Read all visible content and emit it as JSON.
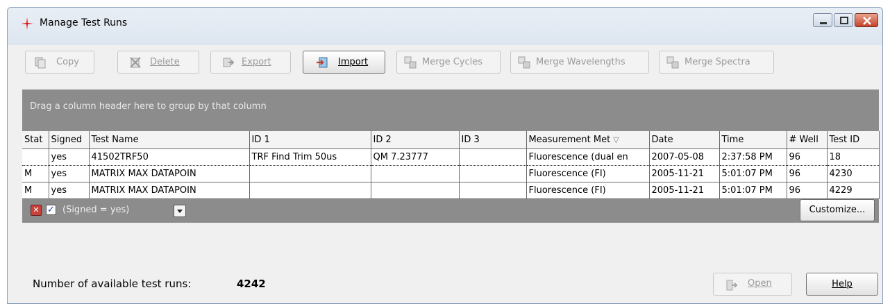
{
  "window": {
    "title": "Manage Test Runs",
    "icon": "red-cross-star-icon"
  },
  "toolbar": {
    "copy": {
      "label": "Copy",
      "icon": "copy-icon",
      "enabled": false
    },
    "delete": {
      "label": "Delete",
      "icon": "delete-icon",
      "enabled": false
    },
    "export": {
      "label": "Export",
      "icon": "export-icon",
      "enabled": false
    },
    "import": {
      "label": "Import",
      "icon": "import-icon",
      "enabled": true
    },
    "merge_cycles": {
      "label": "Merge Cycles",
      "icon": "merge-icon",
      "enabled": false
    },
    "merge_wavelengths": {
      "label": "Merge Wavelengths",
      "icon": "merge-icon",
      "enabled": false
    },
    "merge_spectra": {
      "label": "Merge Spectra",
      "icon": "merge-icon",
      "enabled": false
    }
  },
  "grid": {
    "group_hint": "Drag a column header here to group by that column",
    "columns": [
      "Stat",
      "Signed",
      "Test Name",
      "ID 1",
      "ID 2",
      "ID 3",
      "Measurement Met",
      "Date",
      "Time",
      "# Well",
      "Test ID"
    ],
    "sorted_column": "Measurement Met",
    "rows": [
      [
        "",
        "yes",
        "41502TRF50",
        "TRF Find Trim 50us",
        "QM 7.23777",
        "",
        "Fluorescence (dual en",
        "2007-05-08",
        "2:37:58 PM",
        "96",
        "18"
      ],
      [
        "M",
        "yes",
        "MATRIX  MAX DATAPOIN",
        "",
        "",
        "",
        "Fluorescence (FI)",
        "2005-11-21",
        "5:01:07 PM",
        "96",
        "4230"
      ],
      [
        "M",
        "yes",
        "MATRIX  MAX DATAPOIN",
        "",
        "",
        "",
        "Fluorescence (FI)",
        "2005-11-21",
        "5:01:07 PM",
        "96",
        "4229"
      ]
    ],
    "selected_row": 0
  },
  "filter": {
    "checked": true,
    "text": "(Signed = yes)",
    "customize_label": "Customize..."
  },
  "footer": {
    "count_label": "Number of available test runs:",
    "count_value": "4242",
    "open_label": "Open",
    "help_label": "Help"
  },
  "colors": {
    "accent_red": "#c8413a",
    "panel_gray": "#8c8c8c"
  }
}
